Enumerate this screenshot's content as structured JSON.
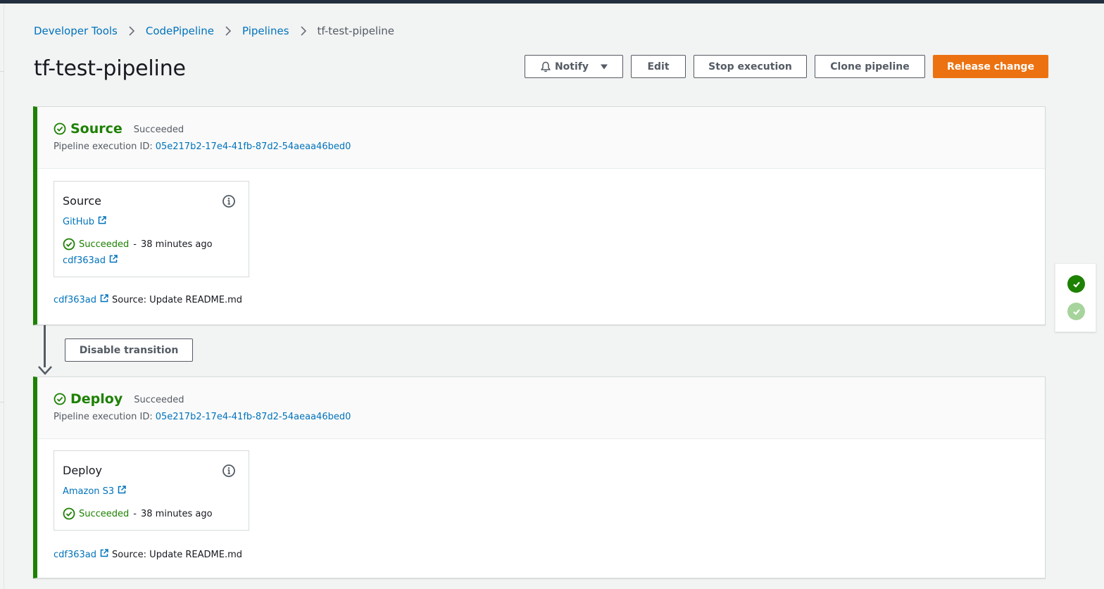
{
  "breadcrumb": {
    "items": [
      "Developer Tools",
      "CodePipeline",
      "Pipelines"
    ],
    "current": "tf-test-pipeline"
  },
  "page": {
    "title": "tf-test-pipeline"
  },
  "actions": {
    "notify": "Notify",
    "edit": "Edit",
    "stop": "Stop execution",
    "clone": "Clone pipeline",
    "release": "Release change"
  },
  "colors": {
    "success": "#1d8102",
    "link": "#0073bb",
    "primary": "#ec7211",
    "nav_bar": "#232f3e"
  },
  "stages": [
    {
      "name": "Source",
      "status": "Succeeded",
      "exec_label": "Pipeline execution ID:",
      "exec_id": "05e217b2-17e4-41fb-87d2-54aeaa46bed0",
      "action": {
        "title": "Source",
        "provider": "GitHub",
        "status": "Succeeded",
        "separator": "-",
        "time": "38 minutes ago",
        "commit": "cdf363ad"
      },
      "footer": {
        "commit": "cdf363ad",
        "message": "Source: Update README.md"
      }
    },
    {
      "name": "Deploy",
      "status": "Succeeded",
      "exec_label": "Pipeline execution ID:",
      "exec_id": "05e217b2-17e4-41fb-87d2-54aeaa46bed0",
      "action": {
        "title": "Deploy",
        "provider": "Amazon S3",
        "status": "Succeeded",
        "separator": "-",
        "time": "38 minutes ago"
      },
      "footer": {
        "commit": "cdf363ad",
        "message": "Source: Update README.md"
      }
    }
  ],
  "transition": {
    "label": "Disable transition"
  },
  "icons": {
    "breadcrumb_separator": "chevron-right-icon",
    "notify": "bell-icon",
    "dropdown": "caret-down-icon",
    "status": "check-circle-icon",
    "info": "info-icon",
    "external": "external-link-icon",
    "transition": "arrow-down-icon"
  }
}
